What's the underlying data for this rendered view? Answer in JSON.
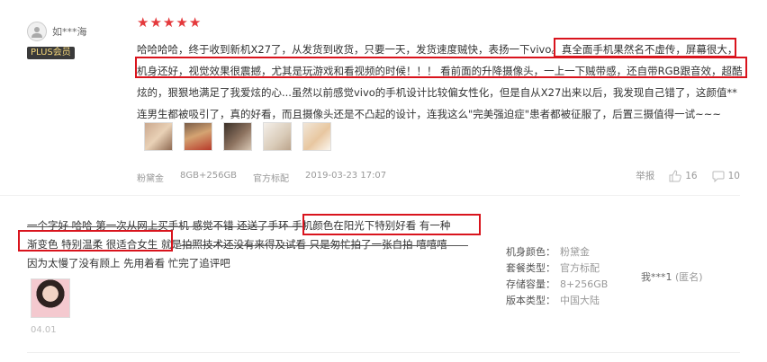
{
  "review1": {
    "username": "如***海",
    "badge": "PLUS会员",
    "rating": 5,
    "text_lines": [
      "哈哈哈哈，终于收到新机X27了，从发货到收货，只要一天，发货速度贼快，表扬一下vivo。真全面手机果然名不虚传，屏幕很大，",
      "机身还好，视觉效果很震撼，尤其是玩游戏和看视频的时候！！！ 看前面的升降摄像头，一上一下贼带感，还自带RGB跟音效，超酷",
      "炫的，狠狠地满足了我爱炫的心...虽然以前感觉vivo的手机设计比较偏女性化，但是自从X27出来以后，我发现自己错了，这颜值**",
      "连男生都被吸引了，真的好看，而且摄像头还是不凸起的设计，连我这么\"完美强迫症\"患者都被征服了，后置三摄值得一试~~~"
    ],
    "meta": {
      "color": "粉黛金",
      "storage": "8GB+256GB",
      "package": "官方标配",
      "datetime": "2019-03-23 17:07"
    },
    "actions": {
      "report_label": "举报",
      "likes": "16",
      "comments": "10"
    }
  },
  "review2": {
    "text_lines": [
      "一个字好 哈哈 第一次从网上买手机 感觉不错 还送了手环 手机颜色在阳光下特别好看 有一种",
      "渐变色 特别温柔 很适合女生 就是拍照技术还没有来得及试看 只是匆忙拍了一张自拍 嘻嘻嘻",
      "因为太慢了没有顾上 先用着看 忙完了追评吧"
    ],
    "date": "04.01",
    "specs": [
      {
        "label": "机身颜色：",
        "value": "粉黛金"
      },
      {
        "label": "套餐类型：",
        "value": "官方标配"
      },
      {
        "label": "存储容量：",
        "value": "8+256GB"
      },
      {
        "label": "版本类型：",
        "value": "中国大陆"
      }
    ],
    "username": "我***1",
    "anonymous": "(匿名)"
  },
  "colors": {
    "highlight_border": "#d9141d",
    "star": "#e4393c",
    "plus_badge_bg": "#3a3a3a",
    "plus_badge_text": "#f5d77a"
  }
}
